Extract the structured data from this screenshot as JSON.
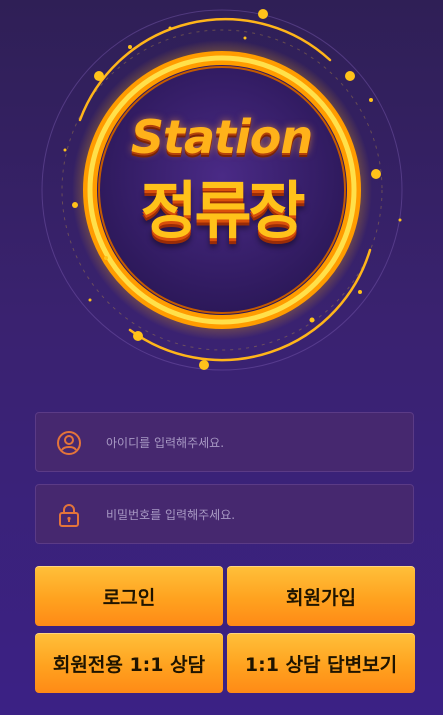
{
  "logo": {
    "brand_en": "Station",
    "brand_ko": "정류장"
  },
  "login_form": {
    "id_placeholder": "아이디를 입력해주세요.",
    "password_placeholder": "비밀번호를 입력해주세요."
  },
  "buttons": {
    "login": "로그인",
    "signup": "회원가입",
    "member_consult": "회원전용 1:1 상담",
    "consult_answers": "1:1 상담 답변보기"
  },
  "icons": {
    "id_field": "user-circle-icon",
    "password_field": "lock-icon"
  },
  "colors": {
    "accent": "#ffa21f",
    "icon": "#e3743a",
    "field_bg": "#46286f"
  }
}
